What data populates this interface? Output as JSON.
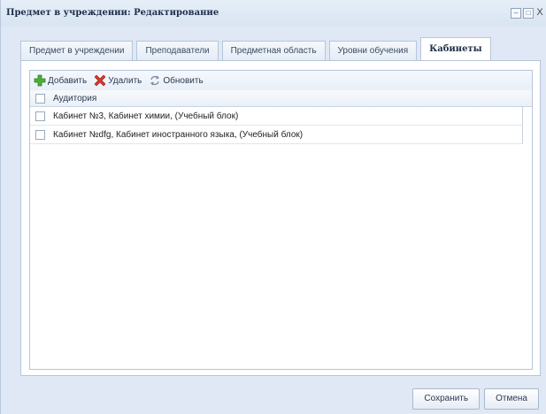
{
  "window": {
    "title": "Предмет в учреждении: Редактирование",
    "controls": {
      "minimize": "–",
      "maximize": "□",
      "close": "X"
    }
  },
  "tabs": [
    {
      "label": "Предмет в учреждении",
      "active": false
    },
    {
      "label": "Преподаватели",
      "active": false
    },
    {
      "label": "Предметная область",
      "active": false
    },
    {
      "label": "Уровни обучения",
      "active": false
    },
    {
      "label": "Кабинеты",
      "active": true
    }
  ],
  "toolbar": {
    "add_label": "Добавить",
    "delete_label": "Удалить",
    "refresh_label": "Обновить",
    "add_icon": "green-plus-icon",
    "delete_icon": "red-x-icon",
    "refresh_icon": "refresh-arrows-icon"
  },
  "grid": {
    "columns": [
      "Аудитория"
    ],
    "rows": [
      {
        "auditorium": "Кабинет №3, Кабинет химии, (Учебный блок)",
        "checked": false
      },
      {
        "auditorium": "Кабинет №dfg, Кабинет иностранного языка, (Учебный блок)",
        "checked": false
      }
    ]
  },
  "footer": {
    "save_label": "Сохранить",
    "cancel_label": "Отмена"
  },
  "colors": {
    "window_bg": "#dfe8f4",
    "add_icon": "#4caf38",
    "delete_icon": "#d9382c"
  }
}
